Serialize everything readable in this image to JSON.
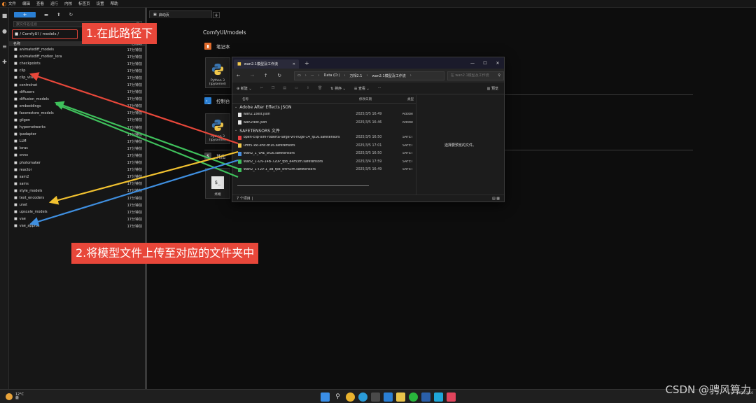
{
  "menubar": {
    "items": [
      "文件",
      "编辑",
      "查看",
      "运行",
      "内核",
      "标签页",
      "设置",
      "帮助"
    ]
  },
  "filebrowser": {
    "search_placeholder": "按文件名过滤",
    "breadcrumb": "/ ComfyUI / models /",
    "col_name": "名称",
    "col_modified": "已修改",
    "rows": [
      {
        "name": "animatediff_models",
        "modified": "17分钟前"
      },
      {
        "name": "animatediff_motion_lora",
        "modified": "17分钟前"
      },
      {
        "name": "checkpoints",
        "modified": "17分钟前"
      },
      {
        "name": "clip",
        "modified": "17分钟前"
      },
      {
        "name": "clip_vision",
        "modified": "17分钟前"
      },
      {
        "name": "controlnet",
        "modified": "17分钟前"
      },
      {
        "name": "diffusers",
        "modified": "17分钟前"
      },
      {
        "name": "diffusion_models",
        "modified": "17分钟前"
      },
      {
        "name": "embeddings",
        "modified": "17分钟前"
      },
      {
        "name": "facerestore_models",
        "modified": "17分钟前"
      },
      {
        "name": "gligen",
        "modified": "17分钟前"
      },
      {
        "name": "hypernetworks",
        "modified": "17分钟前"
      },
      {
        "name": "ipadapter",
        "modified": "17分钟前"
      },
      {
        "name": "LLM",
        "modified": "17分钟前"
      },
      {
        "name": "loras",
        "modified": "17分钟前"
      },
      {
        "name": "onnx",
        "modified": "17分钟前"
      },
      {
        "name": "photomaker",
        "modified": "17分钟前"
      },
      {
        "name": "reactor",
        "modified": "17分钟前"
      },
      {
        "name": "sam2",
        "modified": "17分钟前"
      },
      {
        "name": "sams",
        "modified": "17分钟前"
      },
      {
        "name": "style_models",
        "modified": "17分钟前"
      },
      {
        "name": "text_encoders",
        "modified": "17分钟前"
      },
      {
        "name": "unet",
        "modified": "17分钟前"
      },
      {
        "name": "upscale_models",
        "modified": "17分钟前"
      },
      {
        "name": "vae",
        "modified": "17分钟前"
      },
      {
        "name": "vae_approx",
        "modified": "17分钟前"
      }
    ]
  },
  "callouts": {
    "step1": "1.在此路径下",
    "step2": "2.将模型文件上传至对应的文件夹中"
  },
  "main": {
    "tab_label": "启动页",
    "path": "ComfyUI/models",
    "notebook_section": "笔记本",
    "console_section": "控制台",
    "other_section": "其他",
    "card_python_label": "Python 3 (ipykernel)",
    "card_terminal_label": "终端"
  },
  "explorer": {
    "tab_title": "wan2.1模型及工作流",
    "address": [
      "Data (D:)",
      "万相2.1",
      "wan2.1模型及工作流"
    ],
    "search_placeholder": "在 wan2.1模型及工作流",
    "cmd_new": "新建",
    "cmd_sort": "排序",
    "cmd_view": "查看",
    "cmd_more": "···",
    "cmd_preview": "预览",
    "col_name": "名称",
    "col_date": "修改日期",
    "col_type": "类型",
    "groups": [
      {
        "title": "Adobe After Effects JSON",
        "files": [
          {
            "name": "wan2.1test.json",
            "date": "2025/3/5 16:49",
            "type": "Adobe",
            "color": "#e8e8e8"
          },
          {
            "name": "wan2test.json",
            "date": "2025/3/5 16:46",
            "type": "Adobe",
            "color": "#e8e8e8"
          }
        ]
      },
      {
        "title": "SAFETENSORS 文件",
        "files": [
          {
            "name": "open-clip-xlm-roberta-large-vit-huge-14_fp16.safetensors",
            "date": "2025/3/5 16:50",
            "type": "SAFET",
            "color": "#e84040"
          },
          {
            "name": "umt5-xxl-enc-bf16.safetensors",
            "date": "2025/3/5 17:01",
            "type": "SAFET",
            "color": "#f2c94c"
          },
          {
            "name": "Wan2_1_VAE_bf16.safetensors",
            "date": "2025/3/5 16:50",
            "type": "SAFET",
            "color": "#4a90e2"
          },
          {
            "name": "Wan2_1-I2V-14B-720P_fp8_e4m3fn.safetensors",
            "date": "2025/3/4 17:59",
            "type": "SAFET",
            "color": "#3fc15c"
          },
          {
            "name": "Wan2_1-T2V-1_3B_fp8_e4m3fn.safetensors",
            "date": "2025/3/5 16:49",
            "type": "SAFET",
            "color": "#3fc15c"
          }
        ]
      }
    ],
    "preview_text": "选择要预览的文件。",
    "status": "7 个项目  |"
  },
  "taskbar": {
    "weather_temp": "12°C",
    "weather_desc": "霾",
    "clock_time": "",
    "clock_date": "2025/3/10"
  },
  "watermark": "CSDN @骋风算力",
  "colors": {
    "accent_red": "#e8473a",
    "arrow_red": "#e8473a",
    "arrow_green": "#3fc15c",
    "arrow_yellow": "#f2c230",
    "arrow_blue": "#3f8fe0"
  }
}
